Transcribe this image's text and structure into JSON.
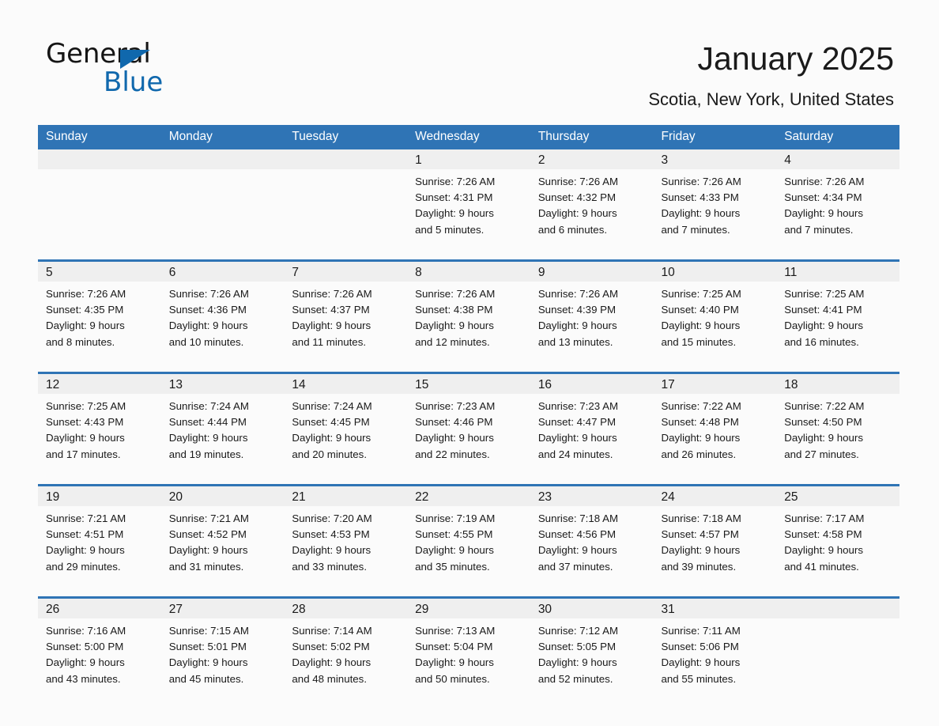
{
  "brand": {
    "name_part1": "General",
    "name_part2": "Blue",
    "accent_color": "#1068ad"
  },
  "header": {
    "title": "January 2025",
    "location": "Scotia, New York, United States"
  },
  "theme": {
    "header_band": "#2f74b5",
    "daynum_band": "#efefef",
    "page_background": "#fbfbfb"
  },
  "calendar": {
    "weekday_headers": [
      "Sunday",
      "Monday",
      "Tuesday",
      "Wednesday",
      "Thursday",
      "Friday",
      "Saturday"
    ],
    "weeks": [
      [
        {
          "day": ""
        },
        {
          "day": ""
        },
        {
          "day": ""
        },
        {
          "day": "1",
          "sunrise": "Sunrise: 7:26 AM",
          "sunset": "Sunset: 4:31 PM",
          "daylight_line1": "Daylight: 9 hours",
          "daylight_line2": "and 5 minutes."
        },
        {
          "day": "2",
          "sunrise": "Sunrise: 7:26 AM",
          "sunset": "Sunset: 4:32 PM",
          "daylight_line1": "Daylight: 9 hours",
          "daylight_line2": "and 6 minutes."
        },
        {
          "day": "3",
          "sunrise": "Sunrise: 7:26 AM",
          "sunset": "Sunset: 4:33 PM",
          "daylight_line1": "Daylight: 9 hours",
          "daylight_line2": "and 7 minutes."
        },
        {
          "day": "4",
          "sunrise": "Sunrise: 7:26 AM",
          "sunset": "Sunset: 4:34 PM",
          "daylight_line1": "Daylight: 9 hours",
          "daylight_line2": "and 7 minutes."
        }
      ],
      [
        {
          "day": "5",
          "sunrise": "Sunrise: 7:26 AM",
          "sunset": "Sunset: 4:35 PM",
          "daylight_line1": "Daylight: 9 hours",
          "daylight_line2": "and 8 minutes."
        },
        {
          "day": "6",
          "sunrise": "Sunrise: 7:26 AM",
          "sunset": "Sunset: 4:36 PM",
          "daylight_line1": "Daylight: 9 hours",
          "daylight_line2": "and 10 minutes."
        },
        {
          "day": "7",
          "sunrise": "Sunrise: 7:26 AM",
          "sunset": "Sunset: 4:37 PM",
          "daylight_line1": "Daylight: 9 hours",
          "daylight_line2": "and 11 minutes."
        },
        {
          "day": "8",
          "sunrise": "Sunrise: 7:26 AM",
          "sunset": "Sunset: 4:38 PM",
          "daylight_line1": "Daylight: 9 hours",
          "daylight_line2": "and 12 minutes."
        },
        {
          "day": "9",
          "sunrise": "Sunrise: 7:26 AM",
          "sunset": "Sunset: 4:39 PM",
          "daylight_line1": "Daylight: 9 hours",
          "daylight_line2": "and 13 minutes."
        },
        {
          "day": "10",
          "sunrise": "Sunrise: 7:25 AM",
          "sunset": "Sunset: 4:40 PM",
          "daylight_line1": "Daylight: 9 hours",
          "daylight_line2": "and 15 minutes."
        },
        {
          "day": "11",
          "sunrise": "Sunrise: 7:25 AM",
          "sunset": "Sunset: 4:41 PM",
          "daylight_line1": "Daylight: 9 hours",
          "daylight_line2": "and 16 minutes."
        }
      ],
      [
        {
          "day": "12",
          "sunrise": "Sunrise: 7:25 AM",
          "sunset": "Sunset: 4:43 PM",
          "daylight_line1": "Daylight: 9 hours",
          "daylight_line2": "and 17 minutes."
        },
        {
          "day": "13",
          "sunrise": "Sunrise: 7:24 AM",
          "sunset": "Sunset: 4:44 PM",
          "daylight_line1": "Daylight: 9 hours",
          "daylight_line2": "and 19 minutes."
        },
        {
          "day": "14",
          "sunrise": "Sunrise: 7:24 AM",
          "sunset": "Sunset: 4:45 PM",
          "daylight_line1": "Daylight: 9 hours",
          "daylight_line2": "and 20 minutes."
        },
        {
          "day": "15",
          "sunrise": "Sunrise: 7:23 AM",
          "sunset": "Sunset: 4:46 PM",
          "daylight_line1": "Daylight: 9 hours",
          "daylight_line2": "and 22 minutes."
        },
        {
          "day": "16",
          "sunrise": "Sunrise: 7:23 AM",
          "sunset": "Sunset: 4:47 PM",
          "daylight_line1": "Daylight: 9 hours",
          "daylight_line2": "and 24 minutes."
        },
        {
          "day": "17",
          "sunrise": "Sunrise: 7:22 AM",
          "sunset": "Sunset: 4:48 PM",
          "daylight_line1": "Daylight: 9 hours",
          "daylight_line2": "and 26 minutes."
        },
        {
          "day": "18",
          "sunrise": "Sunrise: 7:22 AM",
          "sunset": "Sunset: 4:50 PM",
          "daylight_line1": "Daylight: 9 hours",
          "daylight_line2": "and 27 minutes."
        }
      ],
      [
        {
          "day": "19",
          "sunrise": "Sunrise: 7:21 AM",
          "sunset": "Sunset: 4:51 PM",
          "daylight_line1": "Daylight: 9 hours",
          "daylight_line2": "and 29 minutes."
        },
        {
          "day": "20",
          "sunrise": "Sunrise: 7:21 AM",
          "sunset": "Sunset: 4:52 PM",
          "daylight_line1": "Daylight: 9 hours",
          "daylight_line2": "and 31 minutes."
        },
        {
          "day": "21",
          "sunrise": "Sunrise: 7:20 AM",
          "sunset": "Sunset: 4:53 PM",
          "daylight_line1": "Daylight: 9 hours",
          "daylight_line2": "and 33 minutes."
        },
        {
          "day": "22",
          "sunrise": "Sunrise: 7:19 AM",
          "sunset": "Sunset: 4:55 PM",
          "daylight_line1": "Daylight: 9 hours",
          "daylight_line2": "and 35 minutes."
        },
        {
          "day": "23",
          "sunrise": "Sunrise: 7:18 AM",
          "sunset": "Sunset: 4:56 PM",
          "daylight_line1": "Daylight: 9 hours",
          "daylight_line2": "and 37 minutes."
        },
        {
          "day": "24",
          "sunrise": "Sunrise: 7:18 AM",
          "sunset": "Sunset: 4:57 PM",
          "daylight_line1": "Daylight: 9 hours",
          "daylight_line2": "and 39 minutes."
        },
        {
          "day": "25",
          "sunrise": "Sunrise: 7:17 AM",
          "sunset": "Sunset: 4:58 PM",
          "daylight_line1": "Daylight: 9 hours",
          "daylight_line2": "and 41 minutes."
        }
      ],
      [
        {
          "day": "26",
          "sunrise": "Sunrise: 7:16 AM",
          "sunset": "Sunset: 5:00 PM",
          "daylight_line1": "Daylight: 9 hours",
          "daylight_line2": "and 43 minutes."
        },
        {
          "day": "27",
          "sunrise": "Sunrise: 7:15 AM",
          "sunset": "Sunset: 5:01 PM",
          "daylight_line1": "Daylight: 9 hours",
          "daylight_line2": "and 45 minutes."
        },
        {
          "day": "28",
          "sunrise": "Sunrise: 7:14 AM",
          "sunset": "Sunset: 5:02 PM",
          "daylight_line1": "Daylight: 9 hours",
          "daylight_line2": "and 48 minutes."
        },
        {
          "day": "29",
          "sunrise": "Sunrise: 7:13 AM",
          "sunset": "Sunset: 5:04 PM",
          "daylight_line1": "Daylight: 9 hours",
          "daylight_line2": "and 50 minutes."
        },
        {
          "day": "30",
          "sunrise": "Sunrise: 7:12 AM",
          "sunset": "Sunset: 5:05 PM",
          "daylight_line1": "Daylight: 9 hours",
          "daylight_line2": "and 52 minutes."
        },
        {
          "day": "31",
          "sunrise": "Sunrise: 7:11 AM",
          "sunset": "Sunset: 5:06 PM",
          "daylight_line1": "Daylight: 9 hours",
          "daylight_line2": "and 55 minutes."
        },
        {
          "day": ""
        }
      ]
    ]
  }
}
